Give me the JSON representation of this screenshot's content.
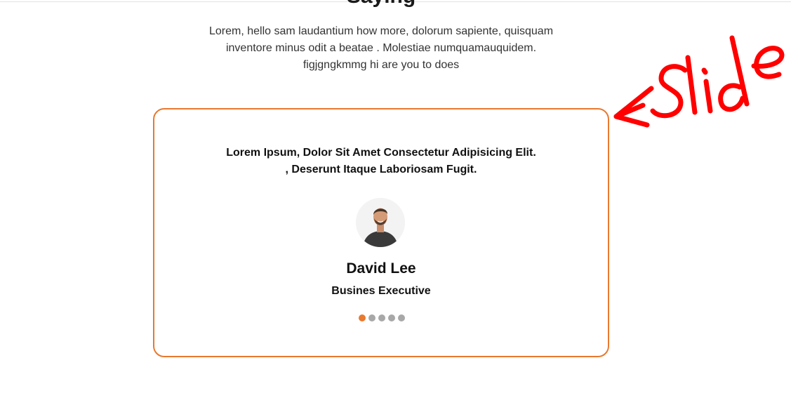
{
  "section": {
    "title": "Saying",
    "intro": "Lorem, hello sam laudantium how more, dolorum sapiente, quisquam inventore minus odit a beatae . Molestiae numquamauquidem. figjgngkmmg hi are you to does"
  },
  "testimonial": {
    "quote": "Lorem Ipsum, Dolor Sit Amet Consectetur Adipisicing Elit. , Deserunt Itaque Laboriosam Fugit.",
    "name": "David Lee",
    "role": "Busines Executive",
    "slide_count": 5,
    "active_slide": 1
  },
  "annotation": {
    "text": "Slide",
    "color": "#ff0000"
  },
  "colors": {
    "accent": "#e8792f",
    "dot_inactive": "#a8a8a8"
  }
}
